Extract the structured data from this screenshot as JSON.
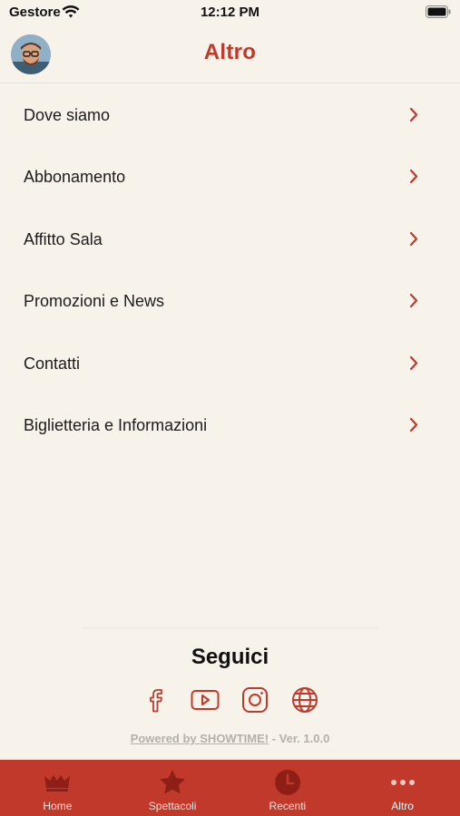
{
  "status_bar": {
    "carrier": "Gestore",
    "time": "12:12 PM"
  },
  "header": {
    "title": "Altro",
    "avatar_icon": "user-avatar"
  },
  "menu": {
    "items": [
      {
        "label": "Dove siamo"
      },
      {
        "label": "Abbonamento"
      },
      {
        "label": "Affitto Sala"
      },
      {
        "label": "Promozioni e News"
      },
      {
        "label": "Contatti"
      },
      {
        "label": "Biglietteria e Informazioni"
      }
    ]
  },
  "follow": {
    "title": "Seguici",
    "icons": [
      "facebook-icon",
      "youtube-icon",
      "instagram-icon",
      "globe-icon"
    ]
  },
  "powered": {
    "prefix": "Powered by ",
    "brand": "SHOWTIME!",
    "version": " - Ver. 1.0.0"
  },
  "tab_bar": {
    "tabs": [
      {
        "label": "Home",
        "icon": "crown-icon"
      },
      {
        "label": "Spettacoli",
        "icon": "star-icon"
      },
      {
        "label": "Recenti",
        "icon": "clock-icon"
      },
      {
        "label": "Altro",
        "icon": "more-dots-icon"
      }
    ],
    "active": "Altro"
  },
  "colors": {
    "accent": "#c0392b",
    "background": "#f7f2ea",
    "tab_icon": "#8e1f16"
  }
}
